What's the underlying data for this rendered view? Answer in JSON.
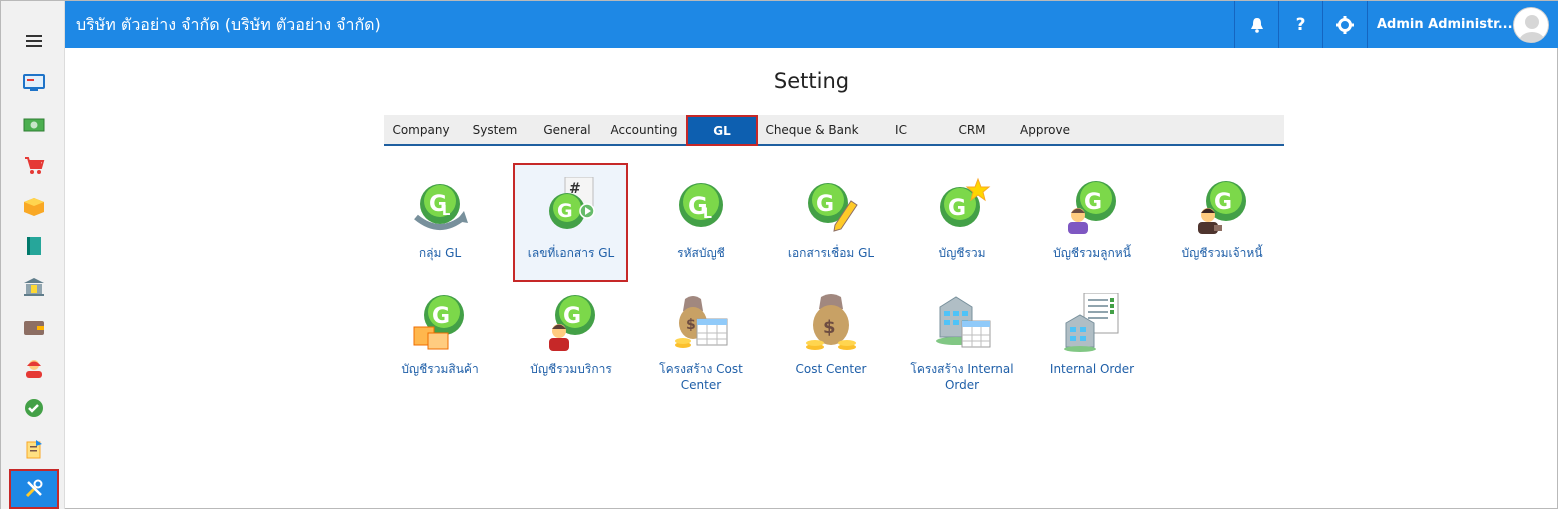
{
  "header": {
    "company": "บริษัท ตัวอย่าง จำกัด (บริษัท ตัวอย่าง จำกัด)",
    "user_name": "Admin Administr...",
    "help_label": "?"
  },
  "page": {
    "title": "Setting"
  },
  "tabs": [
    {
      "label": "Company"
    },
    {
      "label": "System"
    },
    {
      "label": "General"
    },
    {
      "label": "Accounting"
    },
    {
      "label": "GL"
    },
    {
      "label": "Cheque & Bank"
    },
    {
      "label": "IC"
    },
    {
      "label": "CRM"
    },
    {
      "label": "Approve"
    }
  ],
  "tiles": [
    {
      "label": "กลุ่ม GL"
    },
    {
      "label": "เลขที่เอกสาร GL"
    },
    {
      "label": "รหัสบัญชี"
    },
    {
      "label": "เอกสารเชื่อม GL"
    },
    {
      "label": "บัญชีรวม"
    },
    {
      "label": "บัญชีรวมลูกหนี้"
    },
    {
      "label": "บัญชีรวมเจ้าหนี้"
    },
    {
      "label": "บัญชีรวมสินค้า"
    },
    {
      "label": "บัญชีรวมบริการ"
    },
    {
      "label": "โครงสร้าง Cost Center"
    },
    {
      "label": "Cost Center"
    },
    {
      "label": "โครงสร้าง Internal Order"
    },
    {
      "label": "Internal Order"
    }
  ],
  "colors": {
    "header": "#1e88e5",
    "active_tab": "#0d5fb0",
    "highlight": "#c62828",
    "link": "#1f5fa8"
  }
}
